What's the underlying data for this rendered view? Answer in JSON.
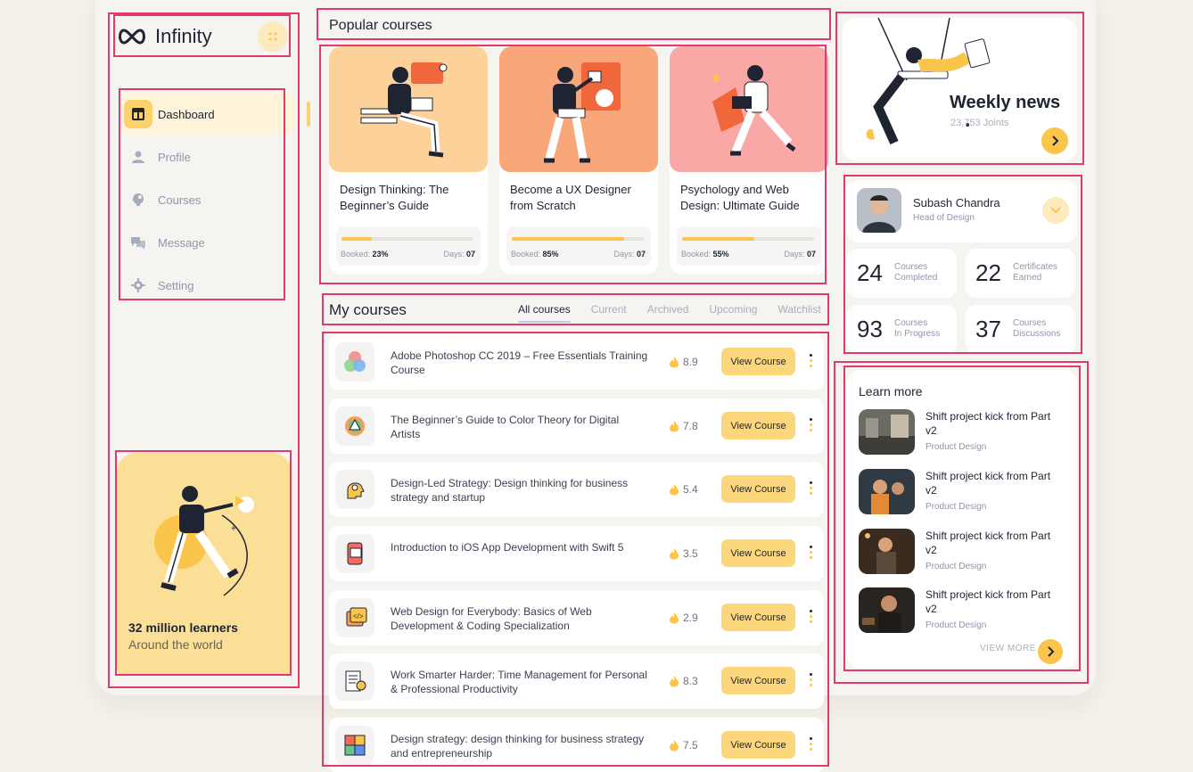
{
  "app": {
    "name": "Infinity"
  },
  "sidebar": {
    "items": [
      {
        "label": "Dashboard",
        "icon": "dashboard-icon",
        "active": true
      },
      {
        "label": "Profile",
        "icon": "user-icon"
      },
      {
        "label": "Courses",
        "icon": "courses-icon"
      },
      {
        "label": "Message",
        "icon": "message-icon"
      },
      {
        "label": "Setting",
        "icon": "gear-icon"
      }
    ],
    "promo": {
      "title": "32 million learners",
      "subtitle": "Around the world"
    }
  },
  "popular": {
    "title": "Popular courses",
    "booked_label": "Booked:",
    "days_label": "Days:",
    "cards": [
      {
        "title": "Design Thinking: The Beginner’s Guide",
        "booked": "23%",
        "booked_fraction": 0.23,
        "days": "07",
        "bg": "#fdd29a"
      },
      {
        "title": "Become a UX Designer from Scratch",
        "booked": "85%",
        "booked_fraction": 0.85,
        "days": "07",
        "bg": "#f9a77a"
      },
      {
        "title": "Psychology and Web Design: Ultimate Guide",
        "booked": "55%",
        "booked_fraction": 0.55,
        "days": "07",
        "bg": "#faa8a6"
      }
    ]
  },
  "my_courses": {
    "title": "My courses",
    "tabs": [
      "All courses",
      "Current",
      "Archived",
      "Upcoming",
      "Watchlist"
    ],
    "view_label": "View Course",
    "items": [
      {
        "title": "Adobe Photoshop CC 2019 – Free Essentials Training Course",
        "rating": "8.9",
        "icon": "rgb-circles-icon"
      },
      {
        "title": "The Beginner’s Guide to Color Theory for Digital Artists",
        "rating": "7.8",
        "icon": "color-wheel-icon"
      },
      {
        "title": "Design-Led Strategy: Design thinking for business strategy and startup",
        "rating": "5.4",
        "icon": "idea-head-icon"
      },
      {
        "title": "Introduction to iOS App Development with Swift 5",
        "rating": "3.5",
        "icon": "phone-code-icon"
      },
      {
        "title": "Web Design for Everybody: Basics of Web Development & Coding Specialization",
        "rating": "2.9",
        "icon": "code-window-icon"
      },
      {
        "title": "Work Smarter Harder: Time Management for Personal & Professional Productivity",
        "rating": "8.3",
        "icon": "checklist-clock-icon"
      },
      {
        "title": "Design strategy: design thinking for business strategy and entrepreneurship",
        "rating": "7.5",
        "icon": "puzzle-icon"
      }
    ]
  },
  "weekly": {
    "title": "Weekly news",
    "subtitle": "23,753 Joints"
  },
  "profile": {
    "name": "Subash Chandra",
    "role": "Head of Design",
    "stats": [
      {
        "num": "24",
        "label1": "Courses",
        "label2": "Completed"
      },
      {
        "num": "22",
        "label1": "Certificates",
        "label2": "Earned"
      },
      {
        "num": "93",
        "label1": "Courses",
        "label2": "In Progress"
      },
      {
        "num": "37",
        "label1": "Courses",
        "label2": "Discussions"
      }
    ]
  },
  "learn_more": {
    "title": "Learn more",
    "view_more": "VIEW MORE",
    "items": [
      {
        "title": "Shift project kick from Part v2",
        "subtitle": "Product Design"
      },
      {
        "title": "Shift project kick from Part v2",
        "subtitle": "Product Design"
      },
      {
        "title": "Shift project kick from Part v2",
        "subtitle": "Product Design"
      },
      {
        "title": "Shift project kick from Part v2",
        "subtitle": "Product Design"
      }
    ]
  },
  "colors": {
    "accent": "#fbc44a",
    "highlight": "#e23a6c",
    "text": "#1f2433"
  }
}
